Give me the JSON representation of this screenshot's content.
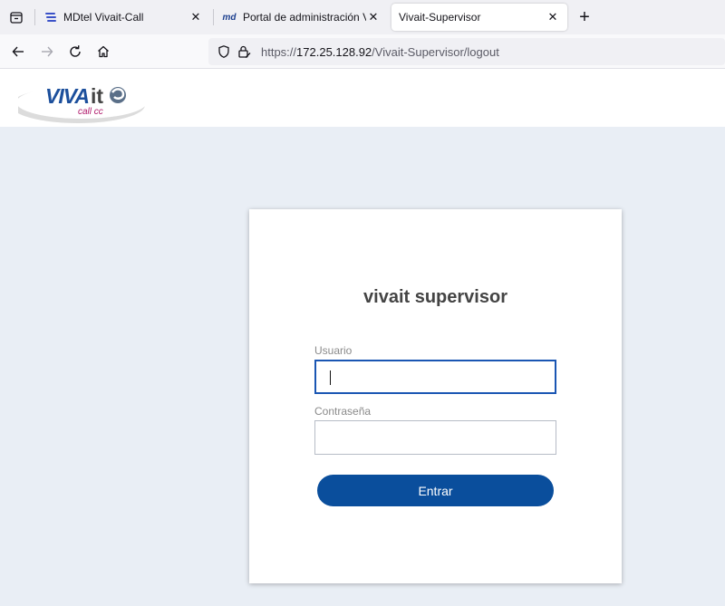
{
  "browser": {
    "tabs": [
      {
        "title": "MDtel Vivait-Call",
        "favicon": "mdtel-lines-icon",
        "active": false
      },
      {
        "title": "Portal de administración VIVAit",
        "favicon_text": "md",
        "active": false
      },
      {
        "title": "Vivait-Supervisor",
        "active": true
      }
    ],
    "close_glyph": "✕",
    "new_tab_glyph": "+",
    "url_prefix": "https://",
    "url_host": "172.25.128.92",
    "url_path": "/Vivait-Supervisor/logout"
  },
  "logo": {
    "brand_main": "VIVA",
    "brand_accent": "it",
    "tagline": "call cc"
  },
  "login": {
    "title": "vivait supervisor",
    "username_label": "Usuario",
    "username_value": "",
    "password_label": "Contraseña",
    "password_value": "",
    "submit_label": "Entrar"
  },
  "colors": {
    "page_background": "#e9eef5",
    "primary_button": "#0a4e9c",
    "focus_border": "#1a56b3",
    "logo_blue": "#1c4f9c",
    "logo_magenta": "#b0196b"
  }
}
